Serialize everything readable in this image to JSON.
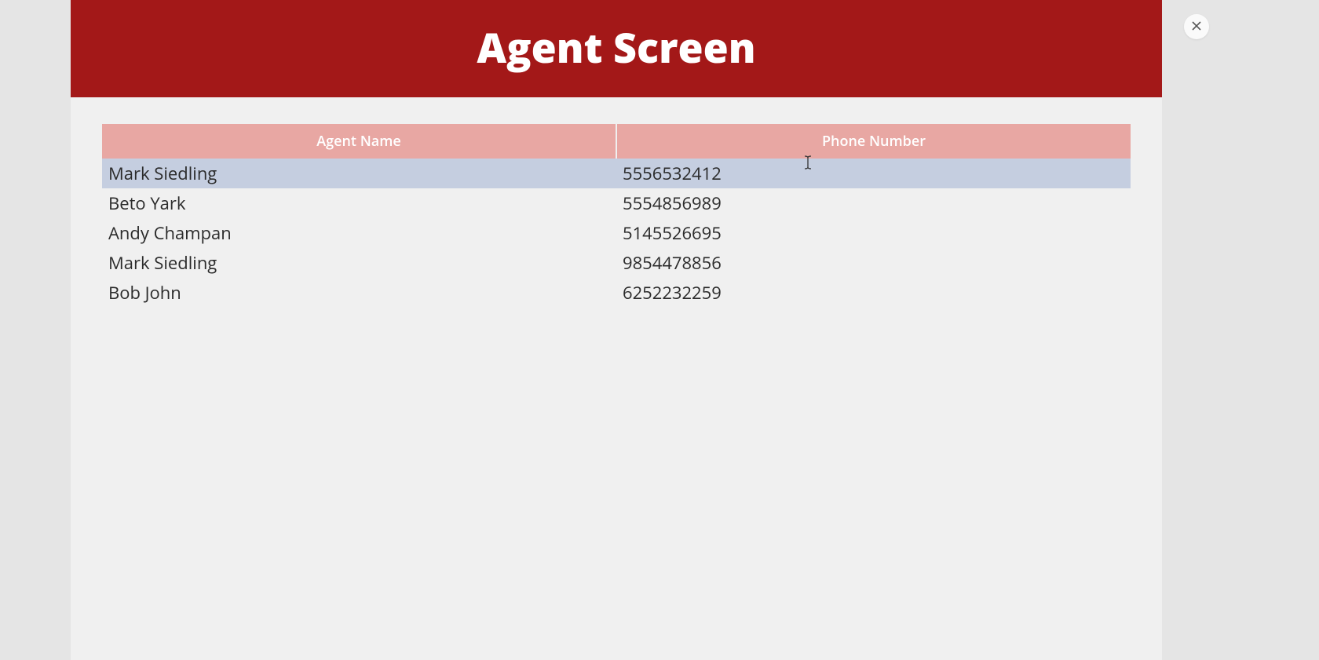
{
  "header": {
    "title": "Agent Screen"
  },
  "table": {
    "columns": [
      "Agent Name",
      "Phone Number"
    ],
    "rows": [
      {
        "name": "Mark Siedling",
        "phone": "5556532412",
        "selected": true
      },
      {
        "name": "Beto Yark",
        "phone": "5554856989",
        "selected": false
      },
      {
        "name": "Andy Champan",
        "phone": "5145526695",
        "selected": false
      },
      {
        "name": "Mark Siedling",
        "phone": "9854478856",
        "selected": false
      },
      {
        "name": "Bob John",
        "phone": "6252232259",
        "selected": false
      }
    ]
  }
}
